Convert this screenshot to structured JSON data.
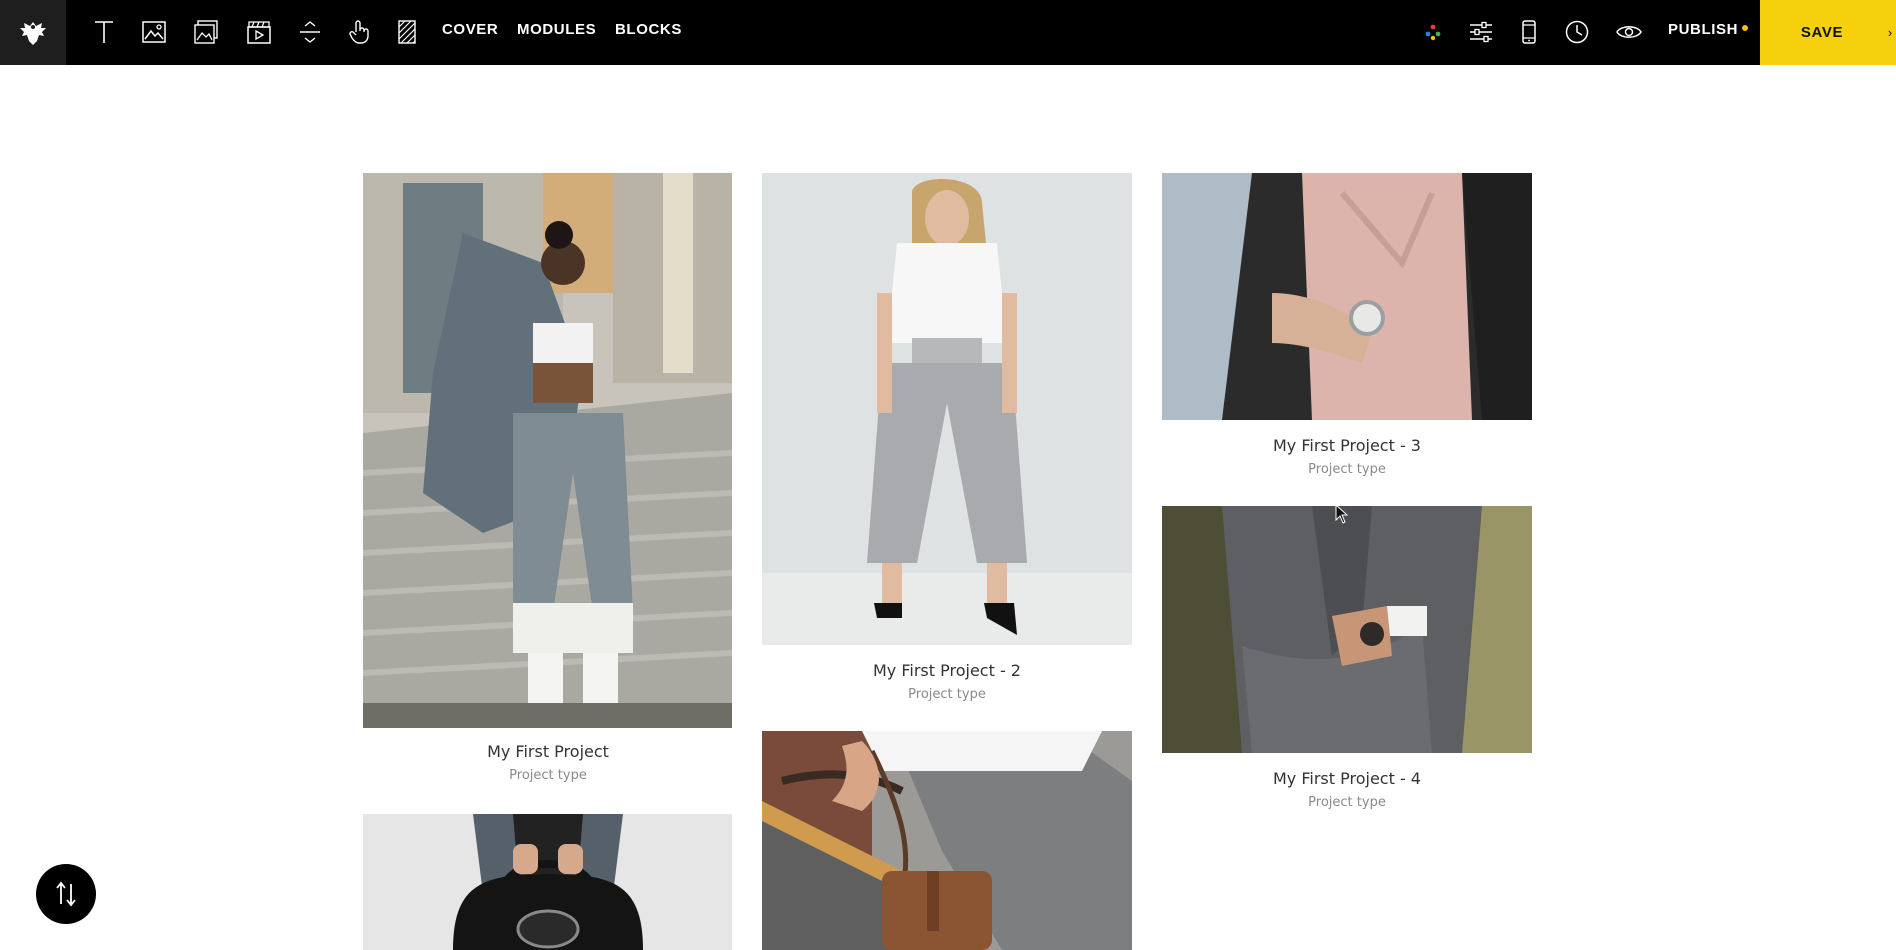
{
  "toolbar": {
    "nav": [
      "COVER",
      "MODULES",
      "BLOCKS"
    ],
    "publish_label": "PUBLISH",
    "save_label": "SAVE",
    "publish_dot_color": "#f4c400",
    "accent": "#f5d10d",
    "icons": {
      "logo": "eagle-logo-icon",
      "tools": [
        "text-icon",
        "image-icon",
        "gallery-icon",
        "video-icon",
        "spacer-icon",
        "hand-pointer-icon",
        "pattern-icon"
      ],
      "right": [
        "palette-dots-icon",
        "sliders-icon",
        "mobile-icon",
        "clock-icon",
        "eye-icon"
      ]
    }
  },
  "projects": [
    {
      "title": "My First Project",
      "type": "Project type"
    },
    {
      "title": "My First Project - 2",
      "type": "Project type"
    },
    {
      "title": "My First Project - 3",
      "type": "Project type"
    },
    {
      "title": "My First Project - 4",
      "type": "Project type"
    }
  ],
  "floating": {
    "icon": "sort-arrows-icon"
  }
}
